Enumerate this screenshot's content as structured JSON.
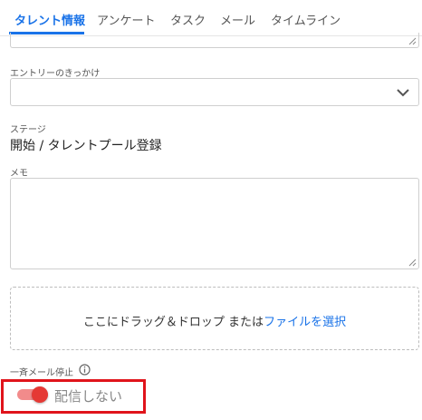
{
  "tabs": [
    {
      "label": "タレント情報",
      "active": true
    },
    {
      "label": "アンケート",
      "active": false
    },
    {
      "label": "タスク",
      "active": false
    },
    {
      "label": "メール",
      "active": false
    },
    {
      "label": "タイムライン",
      "active": false
    }
  ],
  "form": {
    "entry_trigger": {
      "label": "エントリーのきっかけ",
      "value": ""
    },
    "stage": {
      "label": "ステージ",
      "value": "開始 / タレントプール登録"
    },
    "memo": {
      "label": "メモ",
      "value": ""
    },
    "dropzone": {
      "text": "ここにドラッグ＆ドロップ または",
      "link": "ファイルを選択"
    },
    "bulk_mail_stop": {
      "label": "一斉メール停止",
      "toggle_label": "配信しない",
      "enabled": true
    }
  },
  "colors": {
    "accent": "#1a73e8",
    "toggle_on": "#e53935",
    "highlight_border": "#e0141b"
  }
}
